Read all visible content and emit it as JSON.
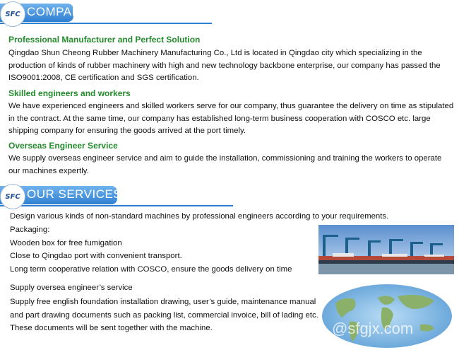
{
  "company": {
    "logo_text": "SFC",
    "banner_title": "COMPANY",
    "sections": [
      {
        "heading": "Professional Manufacturer and Perfect Solution",
        "text": "Qingdao Shun Cheong Rubber Machinery Manufacturing Co., Ltd is located in Qingdao city which specializing in the production of kinds of rubber machinery with high and new technology backbone enterprise, our company has passed the ISO9001:2008, CE certification and SGS certification."
      },
      {
        "heading": "Skilled engineers and workers",
        "text": "We have experienced engineers and skilled workers serve for our company, thus guarantee the delivery on time as stipulated in the contract. At the same time, our company has established long-term business cooperation with COSCO etc. large shipping company for ensuring the goods arrived at the port timely."
      },
      {
        "heading": "Overseas Engineer Service",
        "text": "We supply overseas engineer service and aim to guide the installation, commissioning and training the workers to operate our machines expertly."
      }
    ]
  },
  "services": {
    "logo_text": "SFC",
    "banner_title": "OUR SERVICES",
    "lines": [
      "Design various kinds of non-standard machines by professional engineers according to your requirements.",
      "Packaging:",
      "Wooden box for free fumigation",
      "Close to Qingdao port with convenient transport.",
      "Long term cooperative relation with COSCO, ensure the goods delivery on time",
      "Supply oversea engineer’s service",
      "Supply free english foundation installation drawing, user’s guide, maintenance manual",
      "and part drawing documents such as packing list, commercial invoice, bill of lading etc.",
      "These documents will be sent together with the machine."
    ],
    "watermark": "@sfgjx.com"
  }
}
